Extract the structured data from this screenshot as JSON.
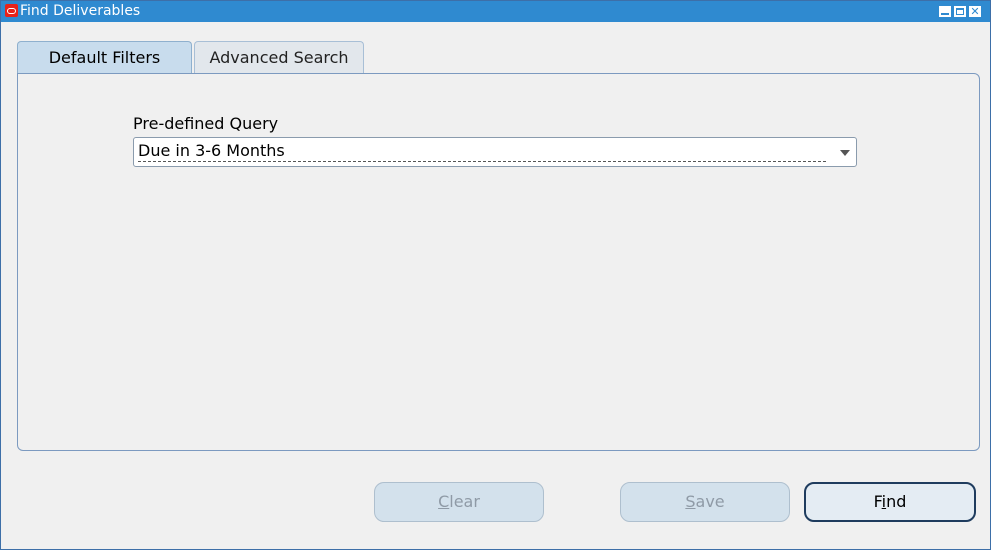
{
  "window": {
    "title": "Find Deliverables",
    "controls": {
      "minimize_icon": "minimize-icon",
      "maximize_icon": "maximize-icon",
      "close_icon": "close-icon",
      "close_glyph": "✕"
    }
  },
  "tabs": [
    {
      "label": "Default Filters",
      "active": true
    },
    {
      "label": "Advanced Search",
      "active": false
    }
  ],
  "form": {
    "predefined_query": {
      "label": "Pre-defined Query",
      "value": "Due in 3-6 Months"
    }
  },
  "buttons": {
    "clear": {
      "mnemonic": "C",
      "rest": "lear",
      "enabled": false
    },
    "save": {
      "mnemonic": "S",
      "rest": "ave",
      "enabled": false
    },
    "find": {
      "pre": "F",
      "mnemonic": "i",
      "rest": "nd",
      "enabled": true
    }
  },
  "colors": {
    "titlebar": "#2f8ad0",
    "active_tab": "#c8dced",
    "app_icon": "#e8221a"
  }
}
